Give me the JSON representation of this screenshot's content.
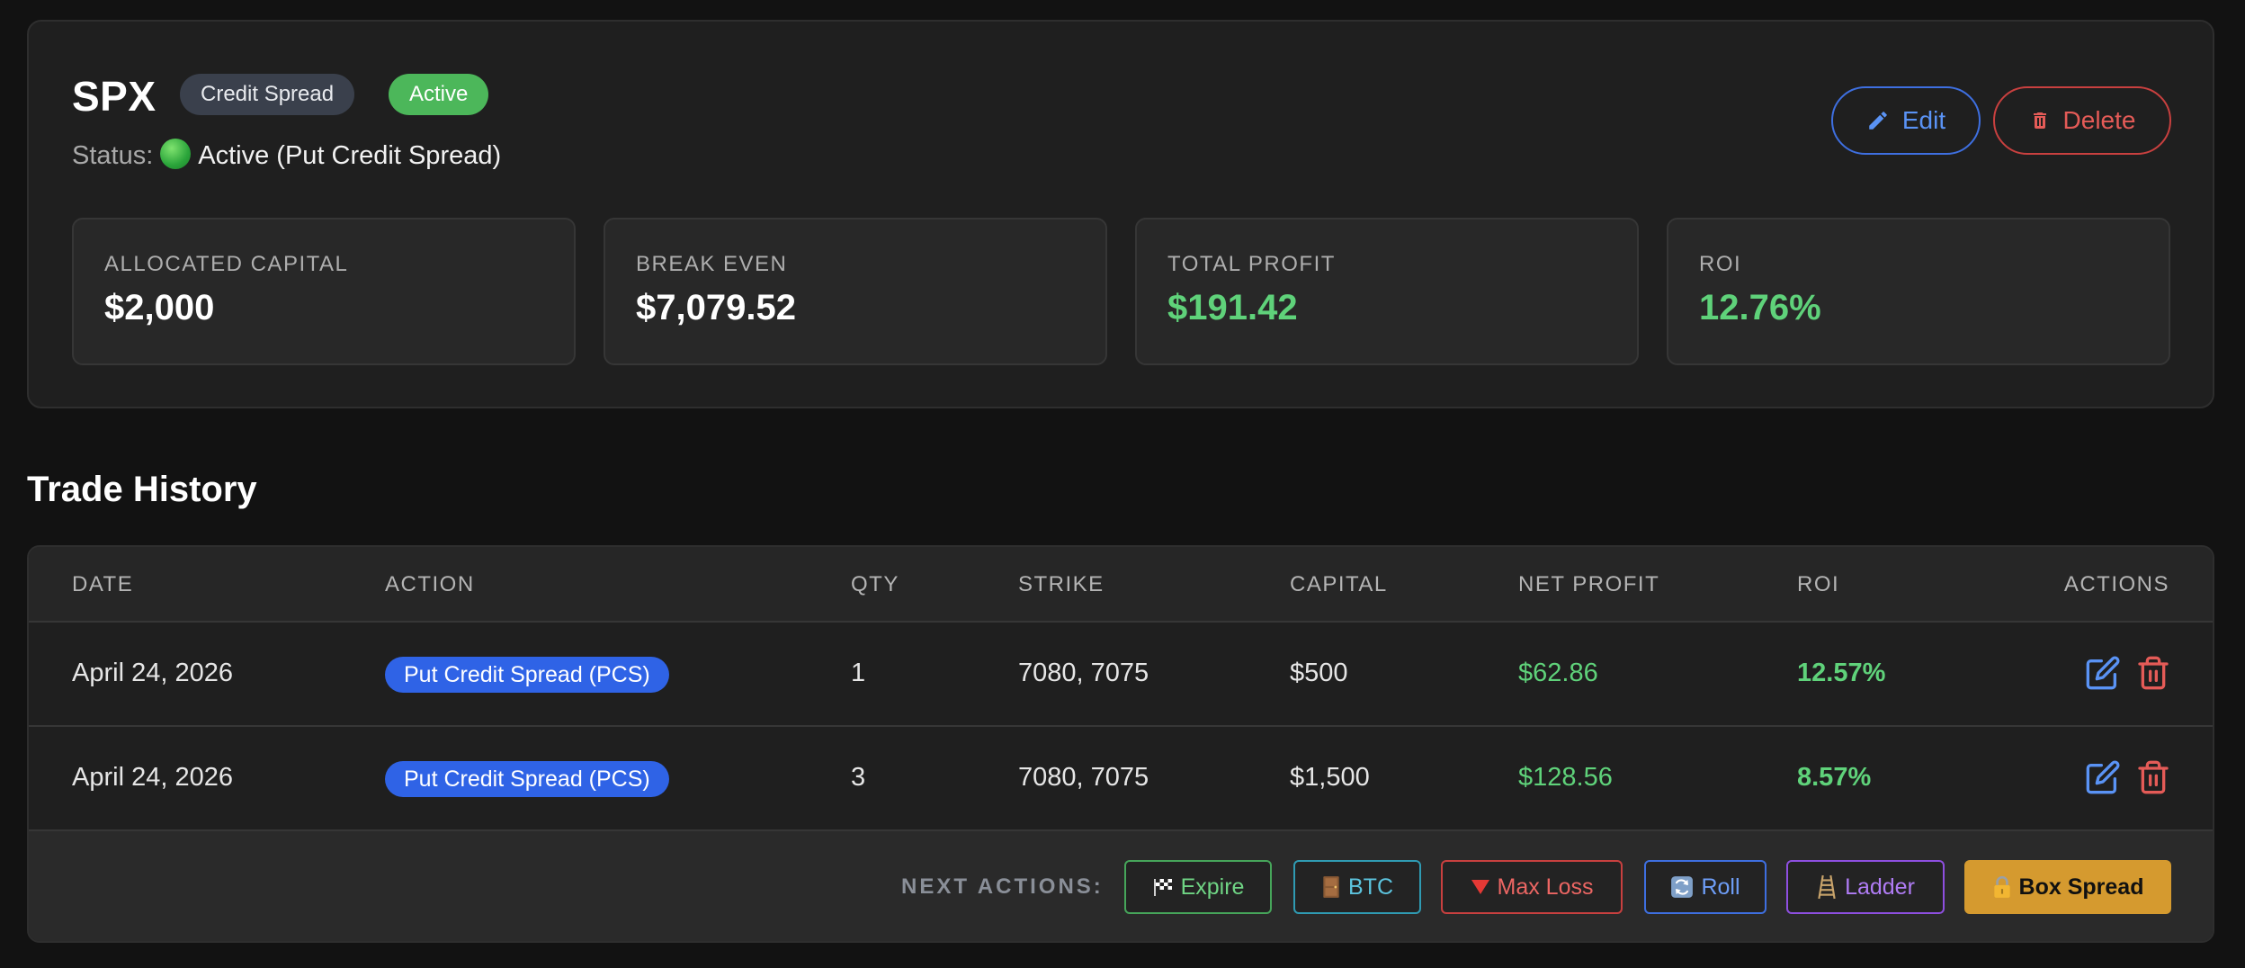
{
  "header": {
    "ticker": "SPX",
    "type_badge": "Credit Spread",
    "status_badge": "Active",
    "status_label": "Status:",
    "status_value": "Active (Put Credit Spread)",
    "edit_label": "Edit",
    "delete_label": "Delete"
  },
  "metrics": [
    {
      "label": "ALLOCATED CAPITAL",
      "value": "$2,000"
    },
    {
      "label": "BREAK EVEN",
      "value": "$7,079.52"
    },
    {
      "label": "TOTAL PROFIT",
      "value": "$191.42"
    },
    {
      "label": "ROI",
      "value": "12.76%"
    }
  ],
  "history": {
    "title": "Trade History",
    "columns": [
      "DATE",
      "ACTION",
      "QTY",
      "STRIKE",
      "CAPITAL",
      "NET PROFIT",
      "ROI",
      "ACTIONS"
    ],
    "rows": [
      {
        "date": "April 24, 2026",
        "action": "Put Credit Spread (PCS)",
        "qty": "1",
        "strike": "7080, 7075",
        "capital": "$500",
        "net_profit": "$62.86",
        "roi": "12.57%"
      },
      {
        "date": "April 24, 2026",
        "action": "Put Credit Spread (PCS)",
        "qty": "3",
        "strike": "7080, 7075",
        "capital": "$1,500",
        "net_profit": "$128.56",
        "roi": "8.57%"
      }
    ]
  },
  "next_actions": {
    "label": "NEXT ACTIONS:",
    "expire": "Expire",
    "btc": "BTC",
    "max_loss": "Max Loss",
    "roll": "Roll",
    "ladder": "Ladder",
    "box_spread": "Box Spread"
  },
  "icons": {
    "edit": "pencil-icon",
    "delete": "trash-icon",
    "status": "green-circle-icon",
    "expire": "checkered-flag-icon",
    "btc": "door-icon",
    "max_loss": "red-triangle-down-icon",
    "roll": "cycle-arrows-icon",
    "ladder": "ladder-icon",
    "box_spread": "lock-icon"
  },
  "colors": {
    "accent_blue": "#3e6fe0",
    "danger_red": "#c8403f",
    "profit_green": "#5fd27a",
    "active_green": "#4cb75a",
    "box_spread_gold": "#d59a2f"
  }
}
